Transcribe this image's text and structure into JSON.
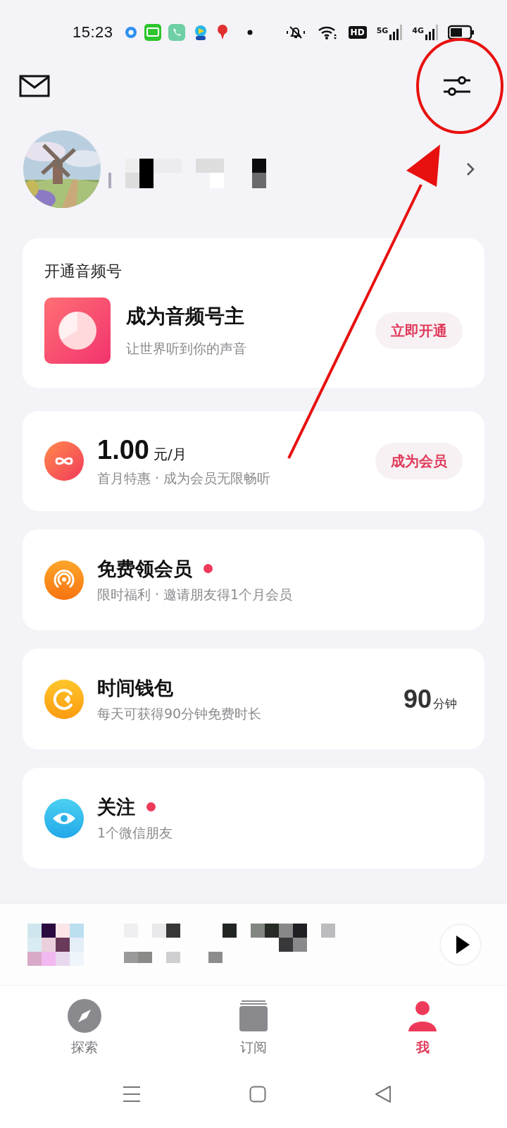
{
  "status_bar": {
    "time": "15:23",
    "hd_label": "HD",
    "network_labels": [
      "5G",
      "4G"
    ]
  },
  "cards": [
    {
      "kind": "open_channel",
      "title": "开通音频号",
      "heading": "成为音频号主",
      "subtitle": "让世界听到你的声音",
      "button": "立即开通"
    },
    {
      "kind": "membership",
      "price": "1.00",
      "unit": "元/月",
      "subtitle": "首月特惠 · 成为会员无限畅听",
      "button": "成为会员"
    },
    {
      "kind": "entry",
      "heading": "免费领会员",
      "new_dot": true,
      "subtitle": "限时福利 · 邀请朋友得1个月会员"
    },
    {
      "kind": "entry",
      "heading": "时间钱包",
      "new_dot": false,
      "subtitle": "每天可获得90分钟免费时长",
      "value": "90",
      "value_unit": "分钟"
    },
    {
      "kind": "entry",
      "heading": "关注",
      "new_dot": true,
      "subtitle": "1个微信朋友"
    }
  ],
  "mini_player": {
    "playing": false
  },
  "tabs": [
    {
      "label": "探索",
      "selected": false
    },
    {
      "label": "订阅",
      "selected": false
    },
    {
      "label": "我",
      "selected": true
    }
  ]
}
